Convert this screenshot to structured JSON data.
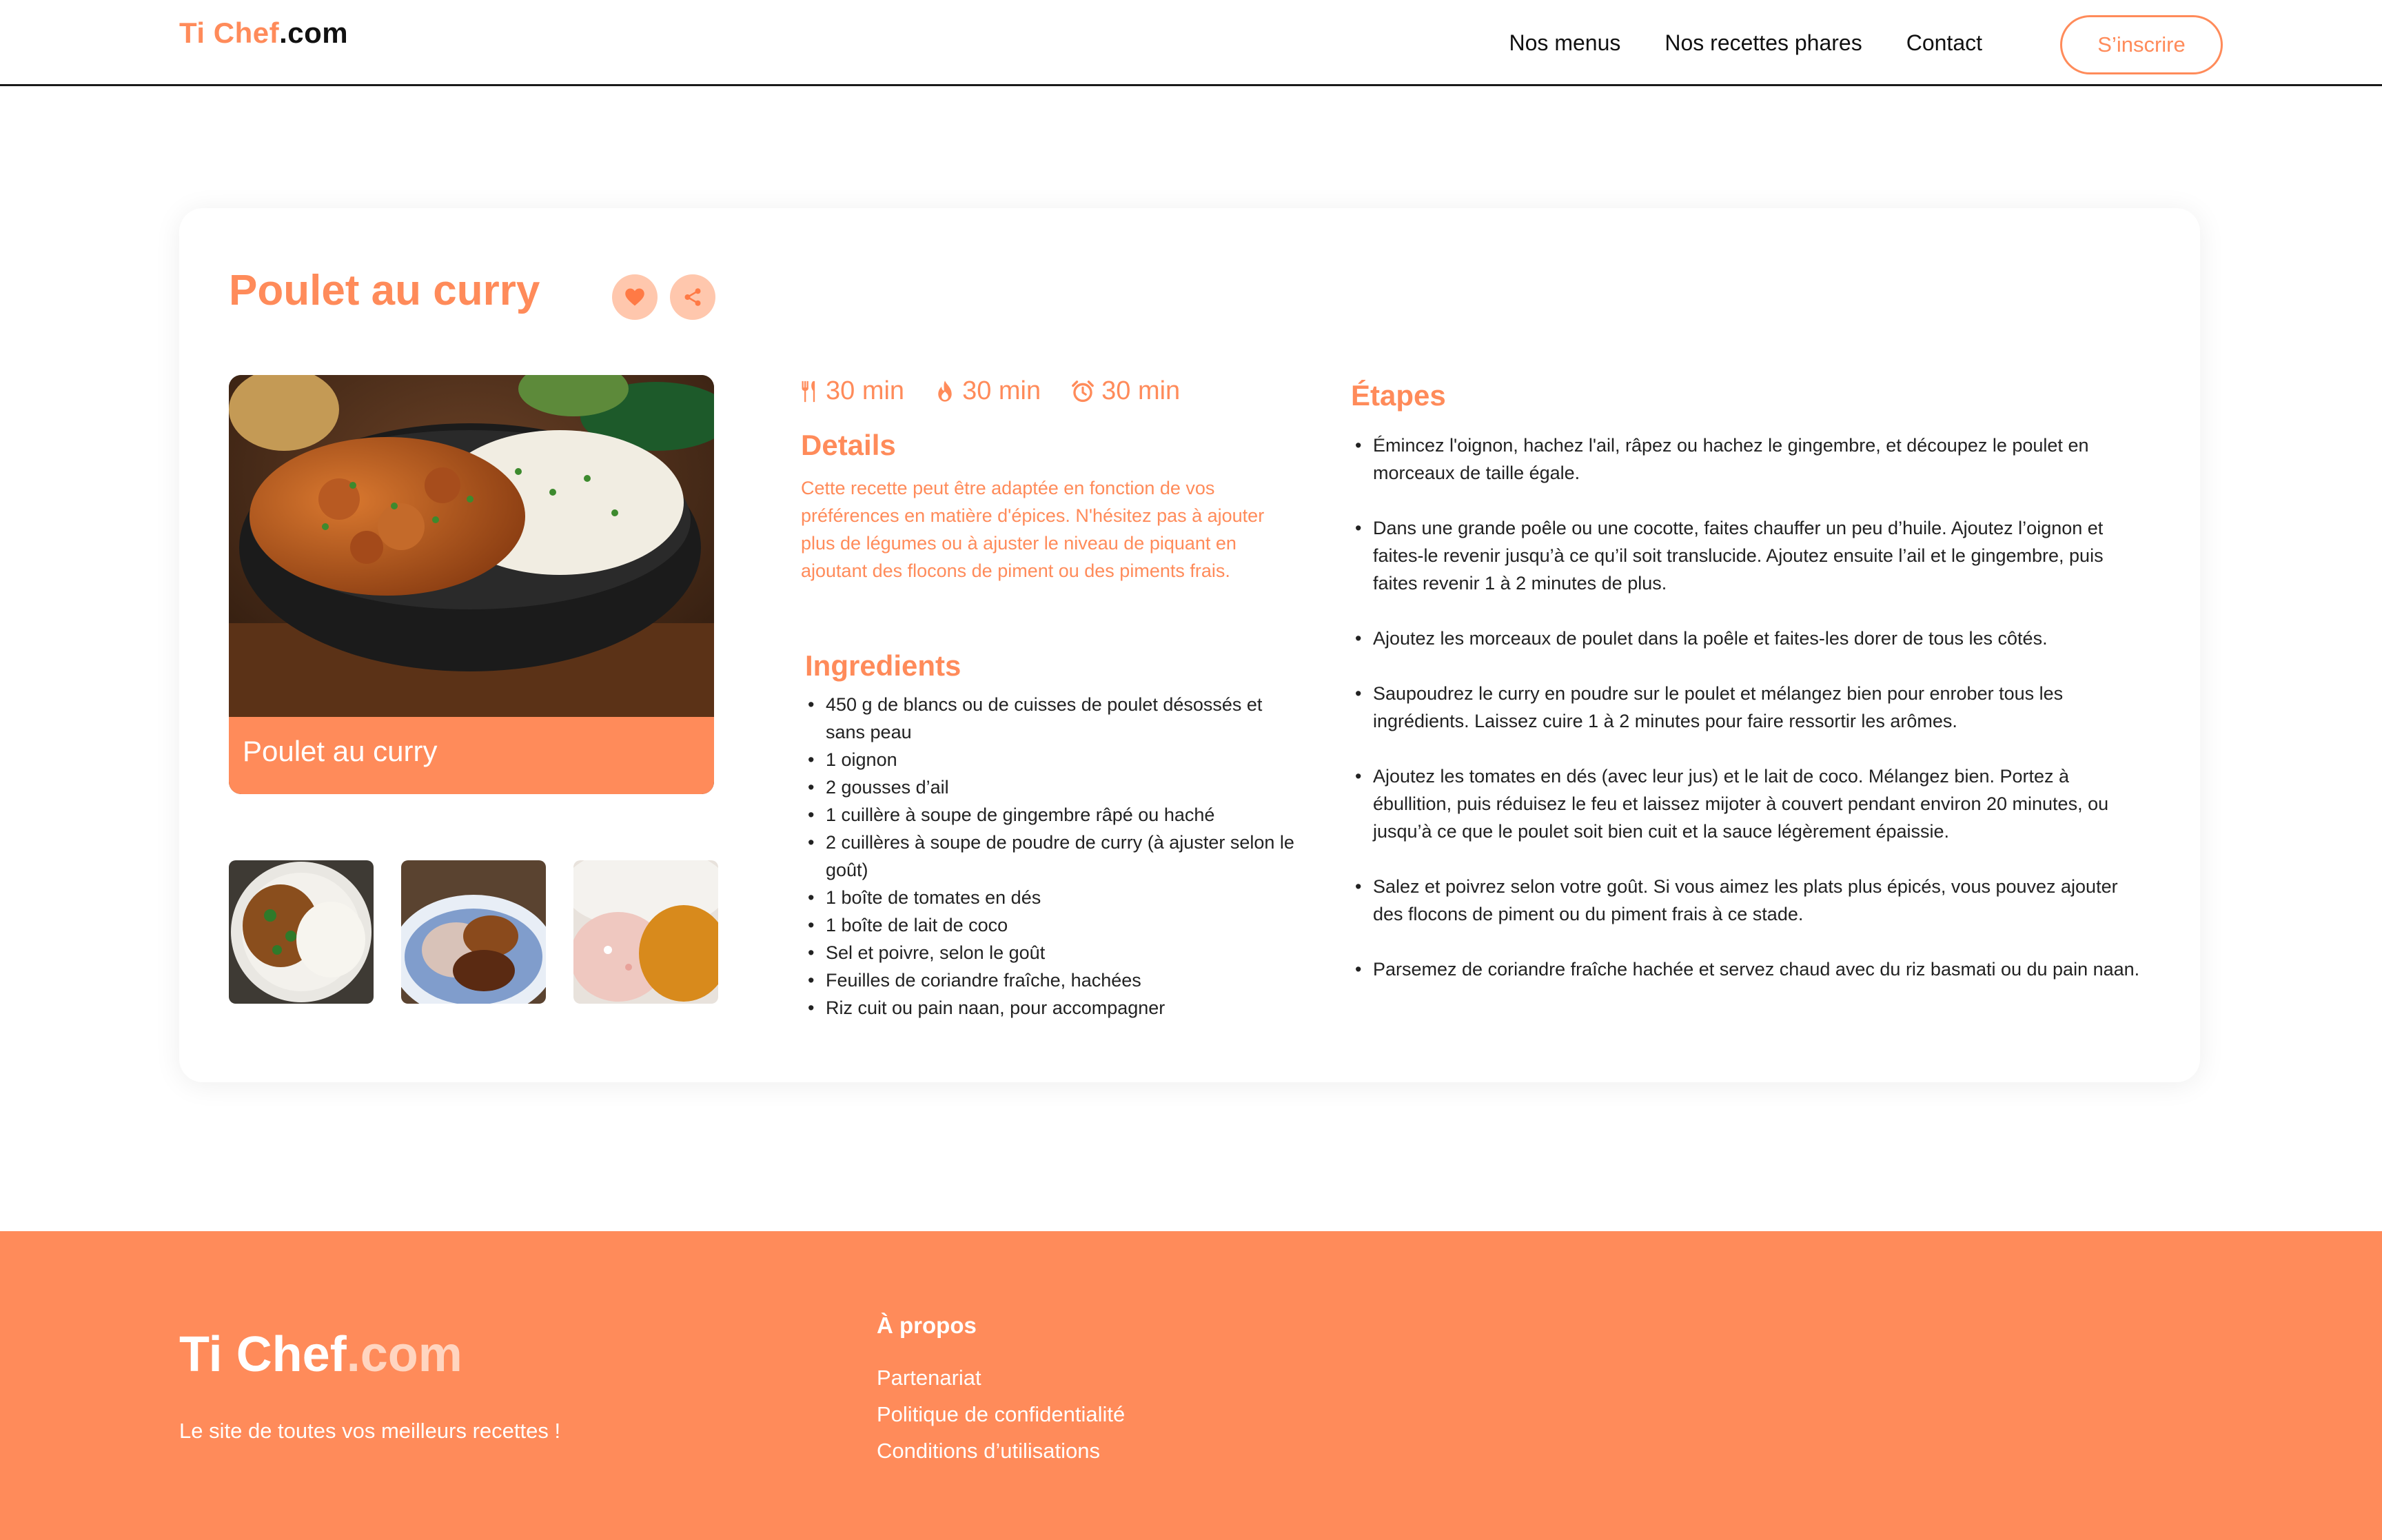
{
  "header": {
    "logo_part1": "Ti Chef",
    "logo_part2": ".com",
    "nav": [
      "Nos menus",
      "Nos recettes phares",
      "Contact"
    ],
    "signup_label": "S’inscrire"
  },
  "recipe": {
    "title": "Poulet au curry",
    "hero_caption": "Poulet au curry",
    "meta": [
      {
        "icon": "utensils-icon",
        "value": "30 min"
      },
      {
        "icon": "flame-icon",
        "value": "30 min"
      },
      {
        "icon": "alarm-clock-icon",
        "value": "30 min"
      }
    ],
    "details_heading": "Details",
    "details_text": "Cette recette peut être adaptée en fonction de vos préférences en matière d'épices. N'hésitez pas à ajouter plus de légumes ou à ajuster le niveau de piquant en ajoutant des flocons de piment ou des piments frais.",
    "ingredients_heading": "Ingredients",
    "ingredients": [
      "450 g de blancs ou de cuisses de poulet désossés et sans peau",
      "1 oignon",
      "2 gousses d’ail",
      "1 cuillère à soupe de gingembre râpé ou haché",
      "2 cuillères à soupe de poudre de curry (à ajuster selon le goût)",
      "1 boîte de tomates en dés",
      "1 boîte de lait de coco",
      "Sel et poivre, selon le goût",
      "Feuilles de coriandre fraîche, hachées",
      "Riz cuit ou pain naan, pour accompagner"
    ],
    "steps_heading": "Étapes",
    "steps": [
      "Émincez l'oignon, hachez l'ail, râpez ou hachez le gingembre, et découpez le poulet en morceaux de taille égale.",
      "Dans une grande poêle ou une cocotte, faites chauffer un peu d’huile. Ajoutez l’oignon et faites-le revenir jusqu’à ce qu’il soit translucide. Ajoutez ensuite l’ail et le gingembre, puis faites revenir 1 à 2 minutes de plus.",
      "Ajoutez les morceaux de poulet dans la poêle et faites-les dorer de tous les côtés.",
      "Saupoudrez le curry en poudre sur le poulet et mélangez bien pour enrober tous les ingrédients. Laissez cuire 1 à 2 minutes pour faire ressortir les arômes.",
      "Ajoutez les tomates en dés (avec leur jus) et le lait de coco. Mélangez bien. Portez à ébullition, puis réduisez le feu et laissez mijoter à couvert pendant environ 20 minutes, ou jusqu’à ce que le poulet soit bien cuit et la sauce légèrement épaissie.",
      "Salez et poivrez selon votre goût. Si vous aimez les plats plus épicés, vous pouvez ajouter des flocons de piment ou du piment frais à ce stade.",
      "Parsemez de coriandre fraîche hachée et servez chaud avec du riz basmati ou du pain naan."
    ]
  },
  "footer": {
    "logo_part1": "Ti Chef",
    "logo_part2": ".com",
    "tagline": "Le site de toutes vos meilleurs recettes !",
    "about_heading": "À propos",
    "links": [
      "Partenariat",
      "Politique de confidentialité",
      "Conditions d’utilisations"
    ]
  },
  "colors": {
    "accent": "#ff8b5a",
    "accent_light": "#ffc7ad",
    "text": "#1a1a1a"
  }
}
